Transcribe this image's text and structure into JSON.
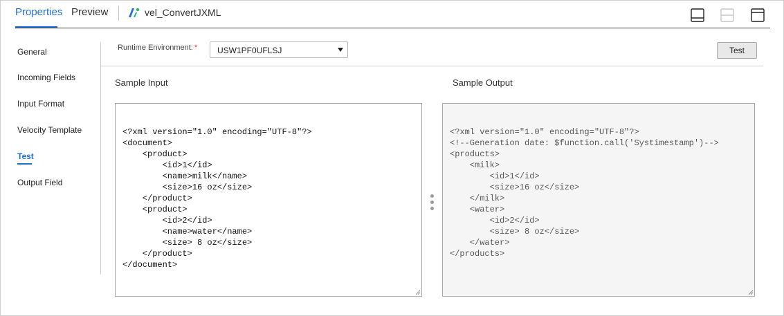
{
  "tabs": {
    "properties": "Properties",
    "preview": "Preview"
  },
  "title": {
    "icon": "velocity-transform-icon",
    "text": "vel_ConvertJXML"
  },
  "layout_icons": [
    "panel-bottom-icon",
    "panel-split-icon",
    "panel-top-icon"
  ],
  "nav": {
    "items": [
      {
        "label": "General"
      },
      {
        "label": "Incoming Fields"
      },
      {
        "label": "Input Format"
      },
      {
        "label": "Velocity Template"
      },
      {
        "label": "Test"
      },
      {
        "label": "Output Field"
      }
    ],
    "active": "Test"
  },
  "runtime": {
    "label": "Runtime Environment:",
    "required_mark": "*",
    "value": "USW1PF0UFLSJ"
  },
  "test_button": "Test",
  "sample_input": {
    "label": "Sample Input",
    "text": "<?xml version=\"1.0\" encoding=\"UTF-8\"?>\n<document>\n    <product>\n        <id>1</id>\n        <name>milk</name>\n        <size>16 oz</size>\n    </product>\n    <product>\n        <id>2</id>\n        <name>water</name>\n        <size> 8 oz</size>\n    </product>\n</document>"
  },
  "sample_output": {
    "label": "Sample Output",
    "text": "<?xml version=\"1.0\" encoding=\"UTF-8\"?>\n<!--Generation date: $function.call('Systimestamp')-->\n<products>\n    <milk>\n        <id>1</id>\n        <size>16 oz</size>\n    </milk>\n    <water>\n        <id>2</id>\n        <size> 8 oz</size>\n    </water>\n</products>"
  },
  "colors": {
    "accent": "#1e6fd9",
    "required": "#d9302c",
    "output_bg": "#f5f5f5"
  }
}
